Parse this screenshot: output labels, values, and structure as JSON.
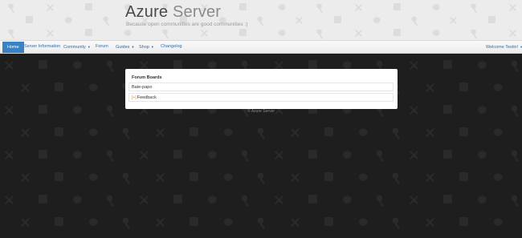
{
  "header": {
    "brand_part1": "Azure",
    "brand_part2": "Server",
    "tagline": "Because open communities are good communities :)"
  },
  "navbar": {
    "items": [
      {
        "label": "Home",
        "active": true
      },
      {
        "label": "Server Information"
      },
      {
        "label": "Community",
        "dropdown": true
      },
      {
        "label": "Forum"
      },
      {
        "label": "Guides",
        "dropdown": true
      },
      {
        "label": "Shop",
        "dropdown": true
      },
      {
        "label": "Changelog"
      }
    ],
    "user_menu": "Welcome Testin!"
  },
  "panel": {
    "title": "Forum Boards",
    "boards": [
      {
        "label": "Bate-papo"
      },
      {
        "label": "Feedback",
        "icon": "[+]"
      }
    ]
  },
  "footer": {
    "text": "· © Azure Server"
  },
  "colors": {
    "accent": "#3a82c4",
    "link": "#2f6ca6",
    "background_dark": "#1e1e1e",
    "header_bg": "#ececec"
  },
  "icons": [
    "key-icon",
    "pickaxe-icon",
    "chest-icon",
    "cookie-icon"
  ]
}
